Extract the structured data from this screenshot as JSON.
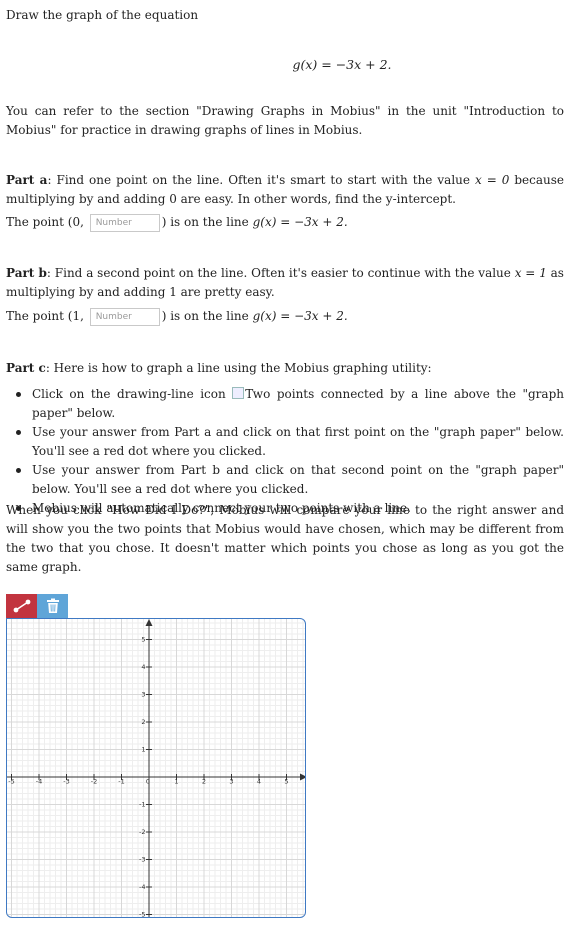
{
  "intro": {
    "text": "Draw the graph of the equation",
    "equation": "g(x) = −3x + 2."
  },
  "refer": {
    "text": "You can refer to the section \"Drawing Graphs in Mobius\" in the unit \"Introduction to Mobius\" for practice in drawing graphs of lines in Mobius."
  },
  "part_a": {
    "label": "Part a",
    "text1": ": Find one point on the line. Often it's smart to start with the value ",
    "var_eq": "x = 0",
    "text2": " because multiplying by and adding 0 are easy. In other words, find the y-intercept.",
    "point_prefix": "The point (0, ",
    "input_placeholder": "Number",
    "point_suffix": ") is on the line ",
    "line_eq": "g(x) = −3x + 2."
  },
  "part_b": {
    "label": "Part b",
    "text1": ": Find a second point on the line. Often it's easier to continue with the value ",
    "var_eq": "x = 1",
    "text2": " as multiplying by and adding 1 are pretty easy.",
    "point_prefix": "The point (1, ",
    "input_placeholder": "Number",
    "point_suffix": ") is on the line ",
    "line_eq": "g(x) = −3x + 2."
  },
  "part_c": {
    "label": "Part c",
    "text": ": Here is how to graph a line using the Mobius graphing utility:",
    "bullets": {
      "b1_pre": "Click on the drawing-line icon ",
      "b1_alt": "Two points connected by a line",
      "b1_post": " above the \"graph paper\" below.",
      "b2": "Use your answer from Part a and click on that first point on the \"graph paper\" below. You'll see a red dot where you clicked.",
      "b3": "Use your answer from Part b and click on that second point on the \"graph paper\" below. You'll see a red dot where you clicked.",
      "b4": "Mobius will automatically connect your two points with a line."
    },
    "closing": "When you click \"How Did I Do?\", Mobius will compare your line to the right answer and will show you the two points that Mobius would have chosen, which may be different from the two that you chose. It doesn't matter which points you chose as long as you got the same graph."
  },
  "toolbar": {
    "line_tool_icon": "line-tool-icon",
    "trash_icon": "trash-icon",
    "line_tool_color": "#c2343f",
    "trash_color": "#5fa5d8"
  },
  "graph": {
    "x_ticks": [
      "-5",
      "-4",
      "-3",
      "-2",
      "-1",
      "0",
      "1",
      "2",
      "3",
      "4",
      "5"
    ],
    "y_ticks_pos": [
      "5",
      "4",
      "3",
      "2",
      "1"
    ],
    "y_ticks_neg": [
      "-1",
      "-2",
      "-3",
      "-4",
      "-5"
    ],
    "border_color": "#3f79c3"
  }
}
